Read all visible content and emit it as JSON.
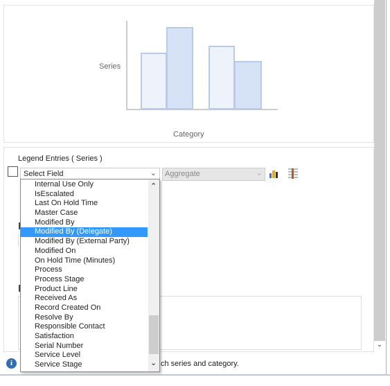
{
  "preview": {
    "y_label": "Series",
    "x_label": "Category"
  },
  "legend": {
    "title": "Legend Entries ( Series )",
    "select_value": "Select Field",
    "aggregate_value": "Aggregate",
    "options": [
      "Internal Use Only",
      "IsEscalated",
      "Last On Hold Time",
      "Master Case",
      "Modified By",
      "Modified By (Delegate)",
      "Modified By (External Party)",
      "Modified On",
      "On Hold Time (Minutes)",
      "Process",
      "Process Stage",
      "Product Line",
      "Received As",
      "Record Created On",
      "Resolve By",
      "Responsible Contact",
      "Satisfaction",
      "Serial Number",
      "Service Level",
      "Service Stage"
    ],
    "selected": "Modified By (Delegate)"
  },
  "info": {
    "text": "ch series and category."
  },
  "colors": {
    "highlight": "#3399ff",
    "bar_fill_light": "#eef3fb",
    "bar_fill_dark": "#d6e2f5"
  }
}
